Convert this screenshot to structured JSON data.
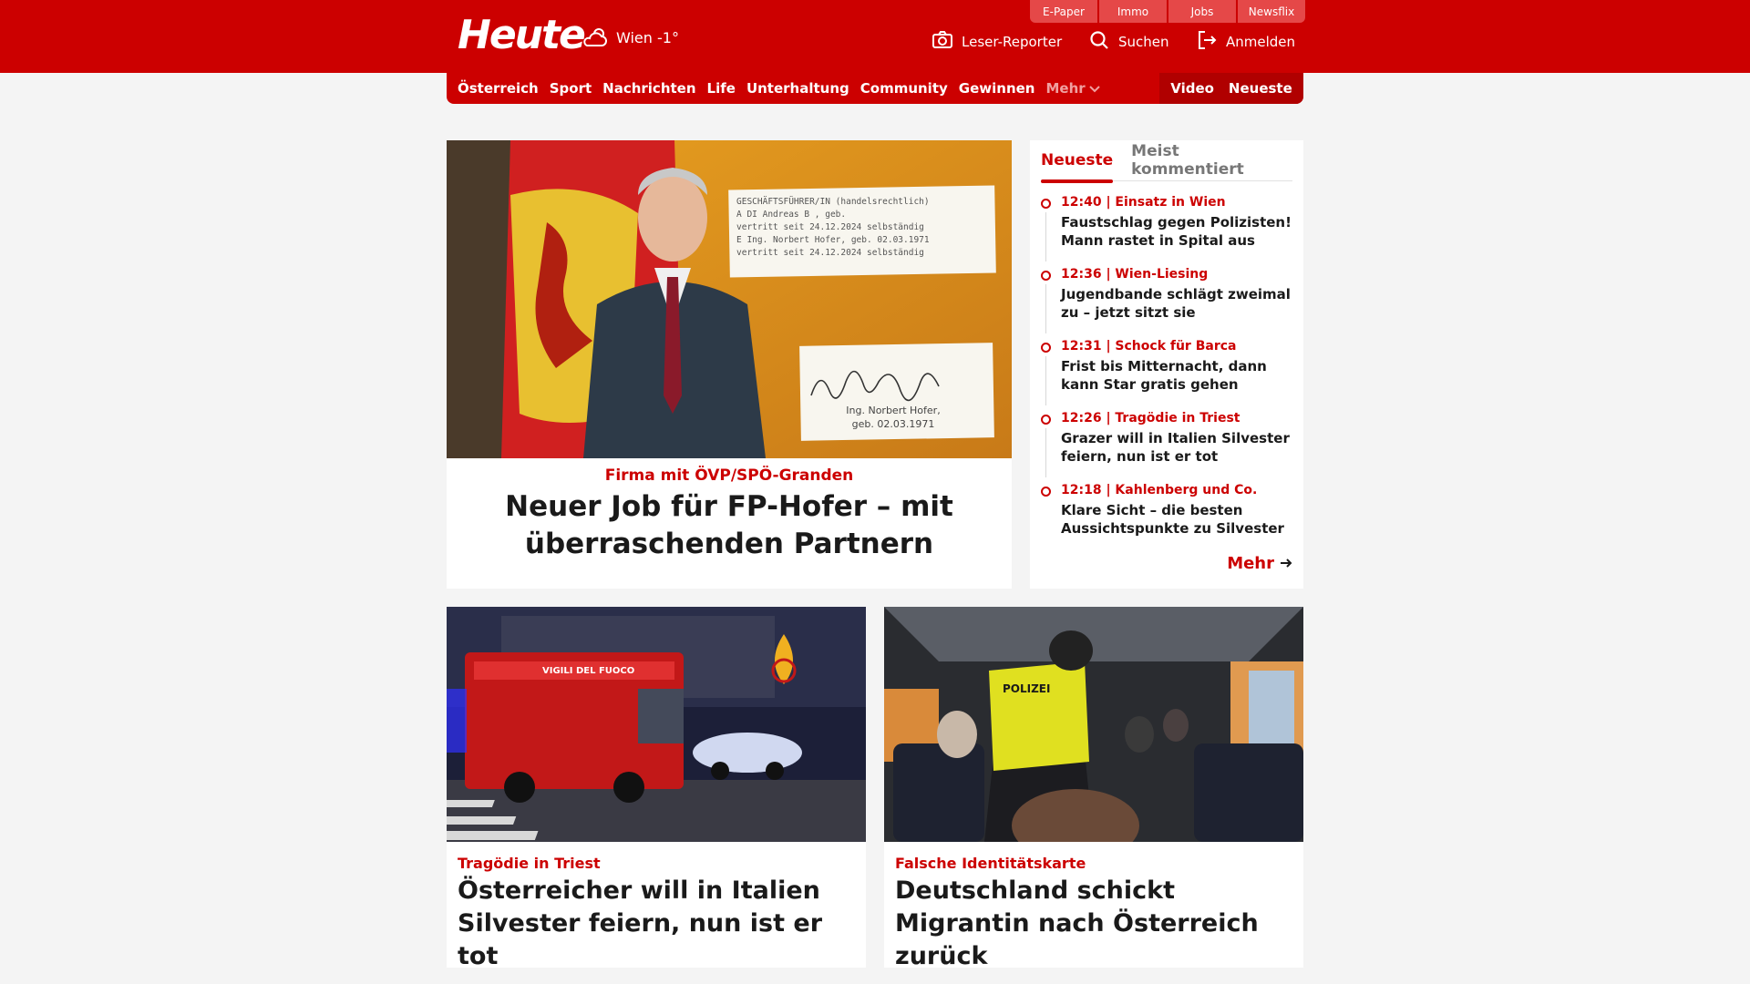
{
  "header": {
    "logo_text": "Heute",
    "weather_text": "Wien -1°",
    "service_tabs": [
      "E-Paper",
      "Immo",
      "Jobs",
      "Newsflix"
    ],
    "actions": {
      "reporter": "Leser-Reporter",
      "search": "Suchen",
      "login": "Anmelden"
    }
  },
  "nav": {
    "items": [
      "Österreich",
      "Sport",
      "Nachrichten",
      "Life",
      "Unterhaltung",
      "Community",
      "Gewinnen"
    ],
    "more_label": "Mehr",
    "right_items": [
      "Video",
      "Neueste"
    ]
  },
  "hero": {
    "image_text": {
      "doc_line1": "GESCHÄFTSFÜHRER/IN (handelsrechtlich)",
      "doc_line2": "A   DI Andreas B      , geb.",
      "doc_line3": "      vertritt seit 24.12.2024 selbständig",
      "doc_line4": "E   Ing. Norbert Hofer, geb. 02.03.1971",
      "doc_line5": "      vertritt seit 24.12.2024 selbständig",
      "sig_name": "Ing. Norbert Hofer,",
      "sig_birth": "geb. 02.03.1971"
    },
    "kicker": "Firma mit ÖVP/SPÖ-Granden",
    "title": "Neuer Job für FP-Hofer – mit überraschenden Partnern"
  },
  "sidebar": {
    "tabs": [
      "Neueste",
      "Meist kommentiert"
    ],
    "items": [
      {
        "meta": "12:40 | Einsatz in Wien",
        "title": "Faustschlag gegen Polizisten! Mann rastet in Spital aus"
      },
      {
        "meta": "12:36 | Wien-Liesing",
        "title": "Jugendbande schlägt zweimal zu – jetzt sitzt sie"
      },
      {
        "meta": "12:31 | Schock für Barca",
        "title": "Frist bis Mitternacht, dann kann Star gratis gehen"
      },
      {
        "meta": "12:26 | Tragödie in Triest",
        "title": "Grazer will in Italien Silvester feiern, nun ist er tot"
      },
      {
        "meta": "12:18 | Kahlenberg und Co.",
        "title": "Klare Sicht – die besten Aussichtspunkte zu Silvester"
      }
    ],
    "more_label": "Mehr"
  },
  "stories": [
    {
      "kicker": "Tragödie in Triest",
      "title": "Österreicher will in Italien Silvester feiern, nun ist er tot",
      "image_text": "VIGILI DEL FUOCO"
    },
    {
      "kicker": "Falsche Identitätskarte",
      "title": "Deutschland schickt Migrantin nach Österreich zurück",
      "image_text": "POLIZEI"
    }
  ],
  "colors": {
    "brand_red": "#cc0000",
    "nav_dark_red": "#b00000",
    "background": "#f4f4f4"
  },
  "icons": [
    "cloud-sun-icon",
    "camera-icon",
    "search-icon",
    "login-icon",
    "chevron-down-icon",
    "arrow-right-icon"
  ]
}
